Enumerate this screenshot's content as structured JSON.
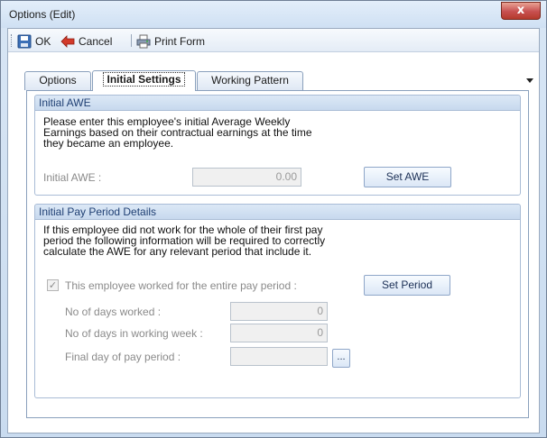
{
  "window": {
    "title": "Options (Edit)",
    "close_glyph": "x"
  },
  "toolbar": {
    "ok_label": "OK",
    "cancel_label": "Cancel",
    "print_label": "Print Form"
  },
  "tabs": [
    {
      "label": "Options",
      "active": false
    },
    {
      "label": "Initial Settings",
      "active": true
    },
    {
      "label": "Working Pattern",
      "active": false
    }
  ],
  "initial_awe": {
    "header": "Initial AWE",
    "description": "Please enter this employee's initial Average Weekly\nEarnings based on their contractual earnings at the time\nthey became an employee.",
    "field_label": "Initial AWE :",
    "field_value": "0.00",
    "button_label": "Set AWE"
  },
  "pay_period": {
    "header": "Initial Pay Period Details",
    "description": "If this employee did not work for the whole of their first pay\nperiod the following information will be required to correctly\ncalculate the AWE for any relevant period that include it.",
    "checkbox_label": "This employee worked for the entire pay period :",
    "checkbox_checked": true,
    "button_label": "Set Period",
    "days_worked_label": "No of days worked :",
    "days_worked_value": "0",
    "days_week_label": "No of days in working week :",
    "days_week_value": "0",
    "final_day_label": "Final day of pay period :",
    "final_day_value": "",
    "ellipsis_label": "..."
  },
  "colors": {
    "header_text": "#1f3f73",
    "disabled_text": "#8a8a8a",
    "close_button": "#c75050"
  }
}
